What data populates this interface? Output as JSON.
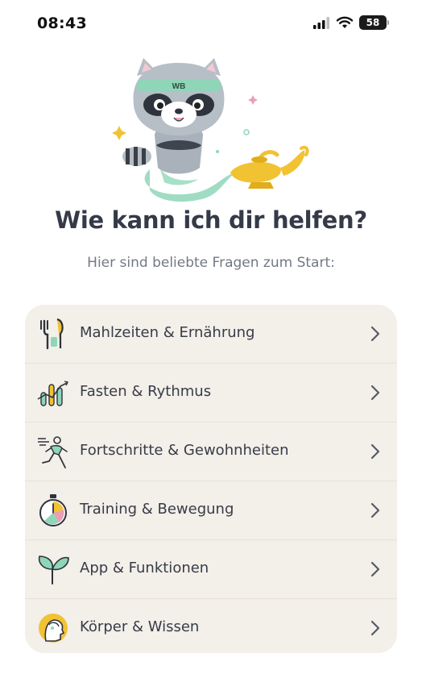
{
  "status_bar": {
    "time": "08:43",
    "battery": "58",
    "icons": [
      "cellular-signal-icon",
      "wifi-icon",
      "battery-icon"
    ]
  },
  "mascot": {
    "headband_text": "WB",
    "icons": [
      "raccoon-mascot-icon",
      "magic-lamp-icon"
    ]
  },
  "header": {
    "title": "Wie kann ich dir helfen?",
    "subtitle": "Hier sind beliebte Fragen zum Start:"
  },
  "topics": [
    {
      "label": "Mahlzeiten & Ernährung",
      "icon": "cutlery-icon"
    },
    {
      "label": "Fasten & Rythmus",
      "icon": "bar-rhythm-icon"
    },
    {
      "label": "Fortschritte & Gewohnheiten",
      "icon": "runner-icon"
    },
    {
      "label": "Training & Bewegung",
      "icon": "stopwatch-icon"
    },
    {
      "label": "App & Funktionen",
      "icon": "sprout-icon"
    },
    {
      "label": "Körper & Wissen",
      "icon": "head-knowledge-icon"
    }
  ],
  "colors": {
    "card_background": "#f3efe9",
    "title": "#353a48",
    "subtitle": "#727886",
    "mint": "#8fd6b8",
    "gold": "#f1c232"
  }
}
